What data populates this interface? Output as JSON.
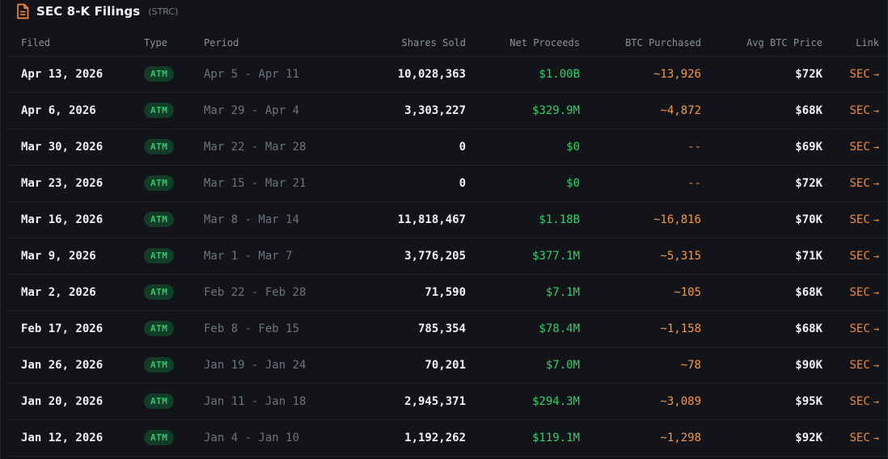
{
  "header": {
    "title": "SEC 8-K Filings",
    "ticker": "(STRC)"
  },
  "columns": {
    "filed": "Filed",
    "type": "Type",
    "period": "Period",
    "shares_sold": "Shares Sold",
    "net_proceeds": "Net Proceeds",
    "btc_purchased": "BTC Purchased",
    "avg_btc_price": "Avg BTC Price",
    "link": "Link"
  },
  "link_arrow": "→",
  "rows": [
    {
      "filed": "Apr 13, 2026",
      "type": "ATM",
      "period": "Apr 5 - Apr 11",
      "shares_sold": "10,028,363",
      "net_proceeds": "$1.00B",
      "btc_purchased": "~13,926",
      "avg_btc_price": "$72K",
      "link": "SEC"
    },
    {
      "filed": "Apr 6, 2026",
      "type": "ATM",
      "period": "Mar 29 - Apr 4",
      "shares_sold": "3,303,227",
      "net_proceeds": "$329.9M",
      "btc_purchased": "~4,872",
      "avg_btc_price": "$68K",
      "link": "SEC"
    },
    {
      "filed": "Mar 30, 2026",
      "type": "ATM",
      "period": "Mar 22 - Mar 28",
      "shares_sold": "0",
      "net_proceeds": "$0",
      "btc_purchased": "--",
      "avg_btc_price": "$69K",
      "link": "SEC"
    },
    {
      "filed": "Mar 23, 2026",
      "type": "ATM",
      "period": "Mar 15 - Mar 21",
      "shares_sold": "0",
      "net_proceeds": "$0",
      "btc_purchased": "--",
      "avg_btc_price": "$72K",
      "link": "SEC"
    },
    {
      "filed": "Mar 16, 2026",
      "type": "ATM",
      "period": "Mar 8 - Mar 14",
      "shares_sold": "11,818,467",
      "net_proceeds": "$1.18B",
      "btc_purchased": "~16,816",
      "avg_btc_price": "$70K",
      "link": "SEC"
    },
    {
      "filed": "Mar 9, 2026",
      "type": "ATM",
      "period": "Mar 1 - Mar 7",
      "shares_sold": "3,776,205",
      "net_proceeds": "$377.1M",
      "btc_purchased": "~5,315",
      "avg_btc_price": "$71K",
      "link": "SEC"
    },
    {
      "filed": "Mar 2, 2026",
      "type": "ATM",
      "period": "Feb 22 - Feb 28",
      "shares_sold": "71,590",
      "net_proceeds": "$7.1M",
      "btc_purchased": "~105",
      "avg_btc_price": "$68K",
      "link": "SEC"
    },
    {
      "filed": "Feb 17, 2026",
      "type": "ATM",
      "period": "Feb 8 - Feb 15",
      "shares_sold": "785,354",
      "net_proceeds": "$78.4M",
      "btc_purchased": "~1,158",
      "avg_btc_price": "$68K",
      "link": "SEC"
    },
    {
      "filed": "Jan 26, 2026",
      "type": "ATM",
      "period": "Jan 19 - Jan 24",
      "shares_sold": "70,201",
      "net_proceeds": "$7.0M",
      "btc_purchased": "~78",
      "avg_btc_price": "$90K",
      "link": "SEC"
    },
    {
      "filed": "Jan 20, 2026",
      "type": "ATM",
      "period": "Jan 11 - Jan 18",
      "shares_sold": "2,945,371",
      "net_proceeds": "$294.3M",
      "btc_purchased": "~3,089",
      "avg_btc_price": "$95K",
      "link": "SEC"
    },
    {
      "filed": "Jan 12, 2026",
      "type": "ATM",
      "period": "Jan 4 - Jan 10",
      "shares_sold": "1,192,262",
      "net_proceeds": "$119.1M",
      "btc_purchased": "~1,298",
      "avg_btc_price": "$92K",
      "link": "SEC"
    }
  ],
  "colors": {
    "background": "#131419",
    "badge_bg": "#123d27",
    "badge_text": "#35c46f",
    "proceeds": "#2fd06a",
    "btc": "#f39846",
    "link": "#f08a3c"
  },
  "icons": {
    "title_icon": "document-icon",
    "link_icon": "arrow-right-icon"
  }
}
